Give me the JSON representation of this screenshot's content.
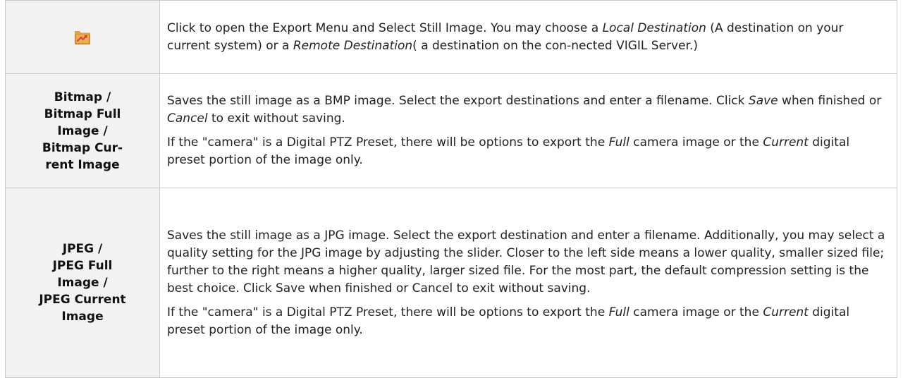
{
  "rows": [
    {
      "icon": "export-folder-icon",
      "desc": [
        [
          "Click to open the Export Menu and Select Still Image. You may choose a ",
          {
            "i": "Local Destination"
          },
          " (A destination on your current system) or a ",
          {
            "i": "Remote Destination"
          },
          "( a destination on the con-nected VIGIL Server.)"
        ]
      ]
    },
    {
      "label_lines": [
        "Bitmap /",
        "Bitmap Full",
        "Image /",
        "Bitmap Cur-",
        "rent Image"
      ],
      "desc": [
        [
          "Saves the still image as a BMP image. Select the export destinations and enter a filename. Click ",
          {
            "i": "Save"
          },
          " when finished or ",
          {
            "i": "Cancel"
          },
          " to exit without saving."
        ],
        [
          "If the \"camera\" is a Digital PTZ Preset, there will be options to export the ",
          {
            "i": "Full"
          },
          " camera image or the ",
          {
            "i": "Current"
          },
          " digital preset portion of the image only."
        ]
      ]
    },
    {
      "label_lines": [
        "JPEG /",
        "JPEG Full",
        "Image /",
        "JPEG Current",
        "Image"
      ],
      "desc": [
        [
          "Saves the still image as a JPG image. Select the export destination and enter a filename. Additionally, you may select a quality setting for the JPG image by adjusting the slider. Closer to the left side means a lower quality, smaller sized file; further to the right means a higher quality, larger sized file. For the most part, the default compression setting is the best choice. Click Save when finished or Cancel to exit without saving."
        ],
        [
          "If the \"camera\" is a Digital PTZ Preset, there will be options to export the ",
          {
            "i": "Full"
          },
          " camera image or the ",
          {
            "i": "Current"
          },
          " digital preset portion of the image only."
        ]
      ]
    }
  ]
}
